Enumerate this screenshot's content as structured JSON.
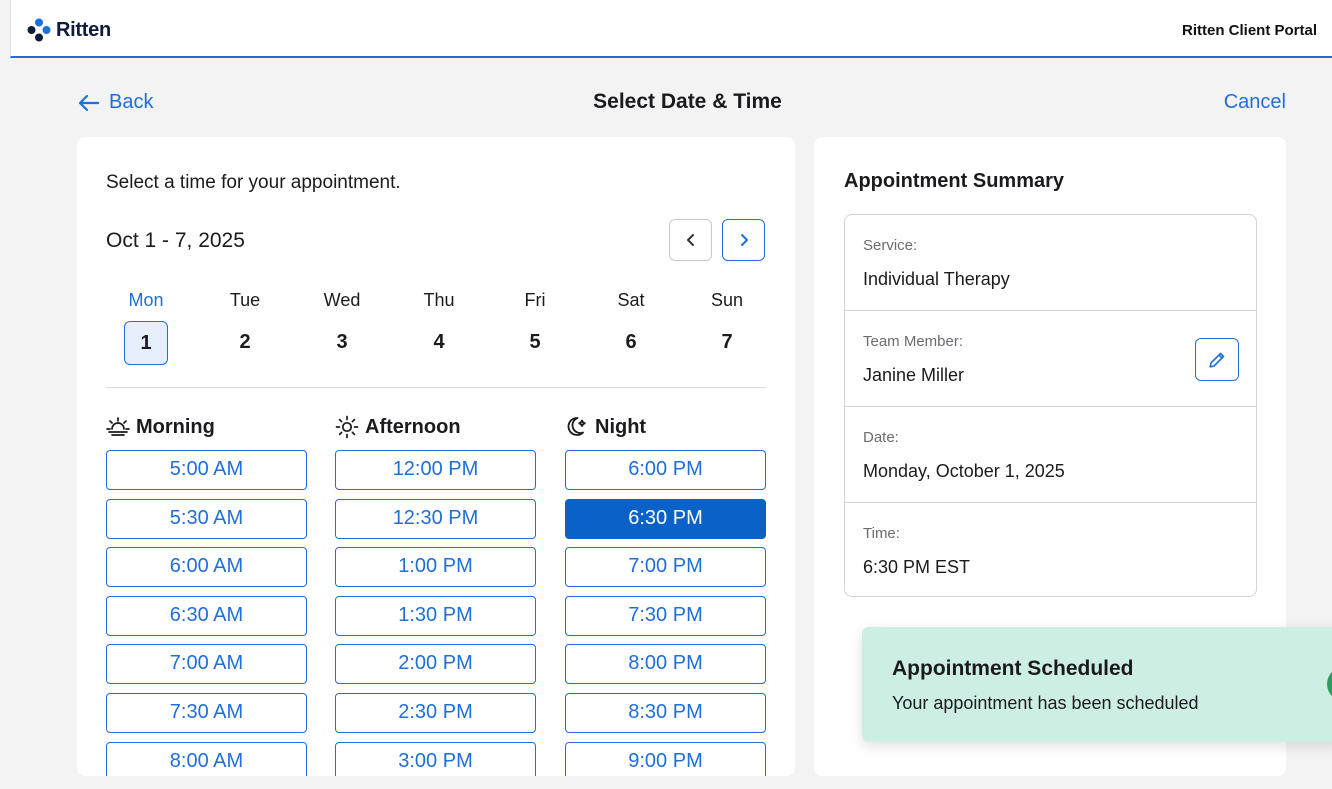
{
  "app": {
    "name": "Ritten",
    "portal_title": "Ritten Client Portal",
    "accent_color": "#1e6fd9"
  },
  "header": {
    "back_label": "Back",
    "page_title": "Select Date & Time",
    "cancel_label": "Cancel"
  },
  "picker": {
    "instruction": "Select a time for your appointment.",
    "date_range": "Oct 1 - 7, 2025",
    "days": [
      {
        "name": "Mon",
        "num": "1",
        "selected": true
      },
      {
        "name": "Tue",
        "num": "2"
      },
      {
        "name": "Wed",
        "num": "3"
      },
      {
        "name": "Thu",
        "num": "4"
      },
      {
        "name": "Fri",
        "num": "5"
      },
      {
        "name": "Sat",
        "num": "6"
      },
      {
        "name": "Sun",
        "num": "7"
      }
    ],
    "columns": [
      {
        "title": "Morning",
        "icon": "sunrise-icon",
        "slots": [
          "5:00 AM",
          "5:30 AM",
          "6:00 AM",
          "6:30 AM",
          "7:00 AM",
          "7:30 AM",
          "8:00 AM"
        ]
      },
      {
        "title": "Afternoon",
        "icon": "sun-icon",
        "slots": [
          "12:00 PM",
          "12:30 PM",
          "1:00 PM",
          "1:30 PM",
          "2:00 PM",
          "2:30 PM",
          "3:00 PM"
        ]
      },
      {
        "title": "Night",
        "icon": "moon-icon",
        "slots": [
          "6:00 PM",
          "6:30 PM",
          "7:00 PM",
          "7:30 PM",
          "8:00 PM",
          "8:30 PM",
          "9:00 PM"
        ]
      }
    ],
    "selected_slot": "6:30 PM"
  },
  "summary": {
    "title": "Appointment Summary",
    "rows": [
      {
        "label": "Service:",
        "value": "Individual Therapy"
      },
      {
        "label": "Team Member:",
        "value": "Janine Miller"
      },
      {
        "label": "Date:",
        "value": "Monday, October 1, 2025"
      },
      {
        "label": "Time:",
        "value": "6:30 PM EST"
      }
    ]
  },
  "toast": {
    "title": "Appointment Scheduled",
    "message": "Your appointment has been scheduled",
    "color": "#cdeee3"
  }
}
